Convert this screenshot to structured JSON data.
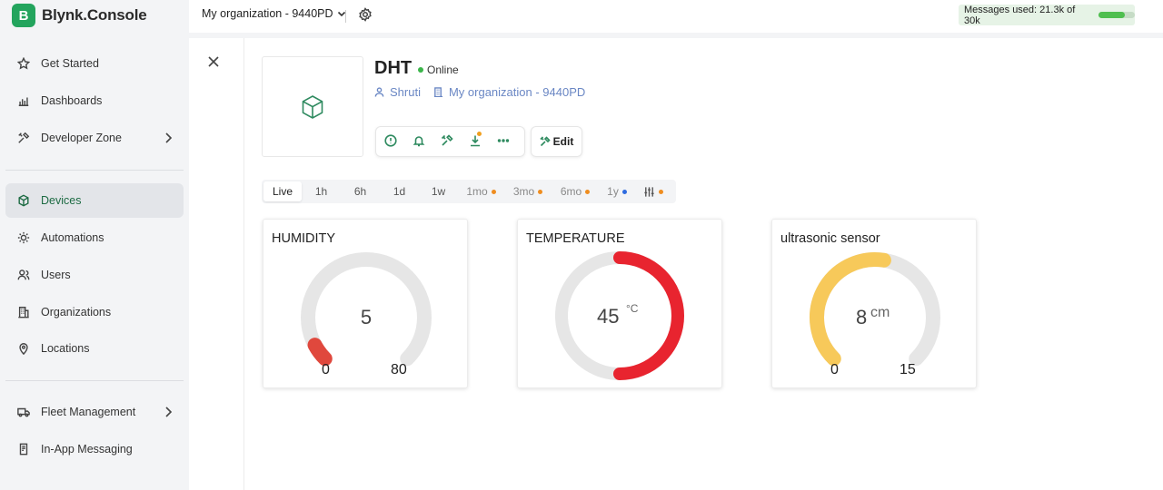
{
  "brand": {
    "logo_letter": "B",
    "name": "Blynk.Console",
    "color": "#23a45d"
  },
  "sidebar": {
    "items": [
      {
        "label": "Get Started",
        "icon": "star-icon"
      },
      {
        "label": "Dashboards",
        "icon": "bar-chart-icon"
      },
      {
        "label": "Developer Zone",
        "icon": "tools-icon",
        "has_submenu": true
      },
      {
        "label": "Devices",
        "icon": "cube-icon",
        "active": true
      },
      {
        "label": "Automations",
        "icon": "sun-icon"
      },
      {
        "label": "Users",
        "icon": "users-icon"
      },
      {
        "label": "Organizations",
        "icon": "building-icon"
      },
      {
        "label": "Locations",
        "icon": "pin-icon"
      },
      {
        "label": "Fleet Management",
        "icon": "truck-icon",
        "has_submenu": true
      },
      {
        "label": "In-App Messaging",
        "icon": "message-icon"
      }
    ]
  },
  "topbar": {
    "org_label": "My organization - 9440PD",
    "messages_used": "Messages used: 21.3k of 30k",
    "messages_fraction": 0.71
  },
  "device": {
    "name": "DHT",
    "status": "Online",
    "owner": "Shruti",
    "organization": "My organization - 9440PD",
    "edit_label": "Edit"
  },
  "time_ranges": [
    {
      "label": "Live",
      "selected": true
    },
    {
      "label": "1h"
    },
    {
      "label": "6h"
    },
    {
      "label": "1d"
    },
    {
      "label": "1w"
    },
    {
      "label": "1mo",
      "dot": "orange"
    },
    {
      "label": "3mo",
      "dot": "orange"
    },
    {
      "label": "6mo",
      "dot": "orange"
    },
    {
      "label": "1y",
      "dot": "blue"
    }
  ],
  "widgets": [
    {
      "title": "HUMIDITY",
      "value": "5",
      "unit": "",
      "min": "0",
      "max": "80",
      "fraction": 0.0625,
      "color": "#e0483d"
    },
    {
      "title": "TEMPERATURE",
      "value": "45",
      "unit": "°C",
      "min": "",
      "max": "",
      "fraction": 0.5,
      "color": "#e8242f"
    },
    {
      "title": "ultrasonic sensor",
      "value": "8",
      "unit": "cm",
      "min": "0",
      "max": "15",
      "fraction": 0.533,
      "color": "#f7c95a"
    }
  ]
}
